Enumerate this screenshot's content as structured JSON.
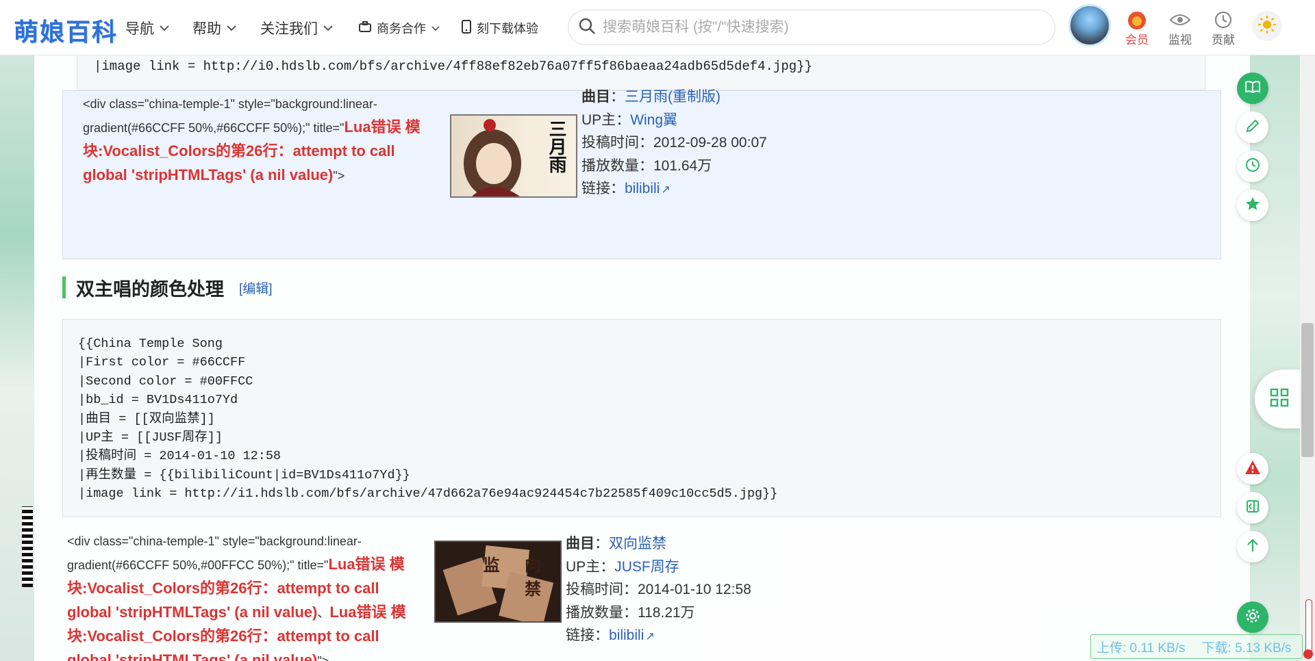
{
  "header": {
    "logo": "萌娘百科",
    "nav": [
      {
        "label": "导航"
      },
      {
        "label": "帮助"
      },
      {
        "label": "关注我们"
      },
      {
        "label": "商务合作"
      },
      {
        "label": "刻下载体验"
      }
    ],
    "search_placeholder": "搜索萌娘百科 (按\"/\"快速搜索)",
    "buttons": {
      "vip": "会员",
      "watch": "监视",
      "contrib": "贡献"
    }
  },
  "top_code": {
    "line": "|image link = http://i0.hdslb.com/bfs/archive/4ff88ef82eb76a07ff5f86baeaa24adb65d5def4.jpg}}"
  },
  "entry1": {
    "div_code_prefix": "<div class=\"china-temple-1\" style=\"background:linear-gradient(#66CCFF 50%,#66CCFF 50%);\" title=\"",
    "div_code_error": "Lua错误 模块:Vocalist_Colors的第26行：attempt to call global 'stripHTMLTags' (a nil value)",
    "div_code_suffix": "\">",
    "thumb_text": "三月雨",
    "song_label": "曲目",
    "song": "三月雨(重制版)",
    "up_label": "UP主",
    "up": "Wing翼",
    "time_label": "投稿时间",
    "time": "2012-09-28 00:07",
    "plays_label": "播放数量",
    "plays": "101.64万",
    "link_label": "链接",
    "link": "bilibili"
  },
  "section": {
    "title": "双主唱的颜色处理",
    "edit": "[编辑]"
  },
  "code_block": {
    "lines": [
      "{{China Temple Song",
      "|First color = #66CCFF",
      "|Second color = #00FFCC",
      "|bb_id = BV1Ds411o7Yd",
      "|曲目 = [[双向监禁]]",
      "|UP主 = [[JUSF周存]]",
      "|投稿时间 = 2014-01-10 12:58",
      "|再生数量 = {{bilibiliCount|id=BV1Ds411o7Yd}}",
      "|image link = http://i1.hdslb.com/bfs/archive/47d662a76e94ac924454c7b22585f409c10cc5d5.jpg}}"
    ]
  },
  "entry2": {
    "div_code_prefix": "<div class=\"china-temple-1\" style=\"background:linear-gradient(#66CCFF 50%,#00FFCC 50%);\" title=\"",
    "div_code_error1": "Lua错误 模块:Vocalist_Colors的第26行：attempt to call global 'stripHTMLTags' (a nil value)",
    "div_code_sep": "、",
    "div_code_error2": "Lua错误 模块:Vocalist_Colors的第26行：attempt to call global 'stripHTMLTags' (a nil value)",
    "div_code_suffix": "\">",
    "thumb_text": "监 向 禁",
    "song_label": "曲目",
    "song": "双向监禁",
    "up_label": "UP主",
    "up": "JUSF周存",
    "time_label": "投稿时间",
    "time": "2014-01-10 12:58",
    "plays_label": "播放数量",
    "plays": "118.21万",
    "link_label": "链接",
    "link": "bilibili"
  },
  "speed_widget": {
    "upload": "上传: 0.11 KB/s",
    "download": "下载: 5.13 KB/s"
  },
  "colors": {
    "accent_green": "#2db56a",
    "link_blue": "#2a62b8",
    "error_red": "#d33333",
    "section_bar": "#4cc261"
  }
}
